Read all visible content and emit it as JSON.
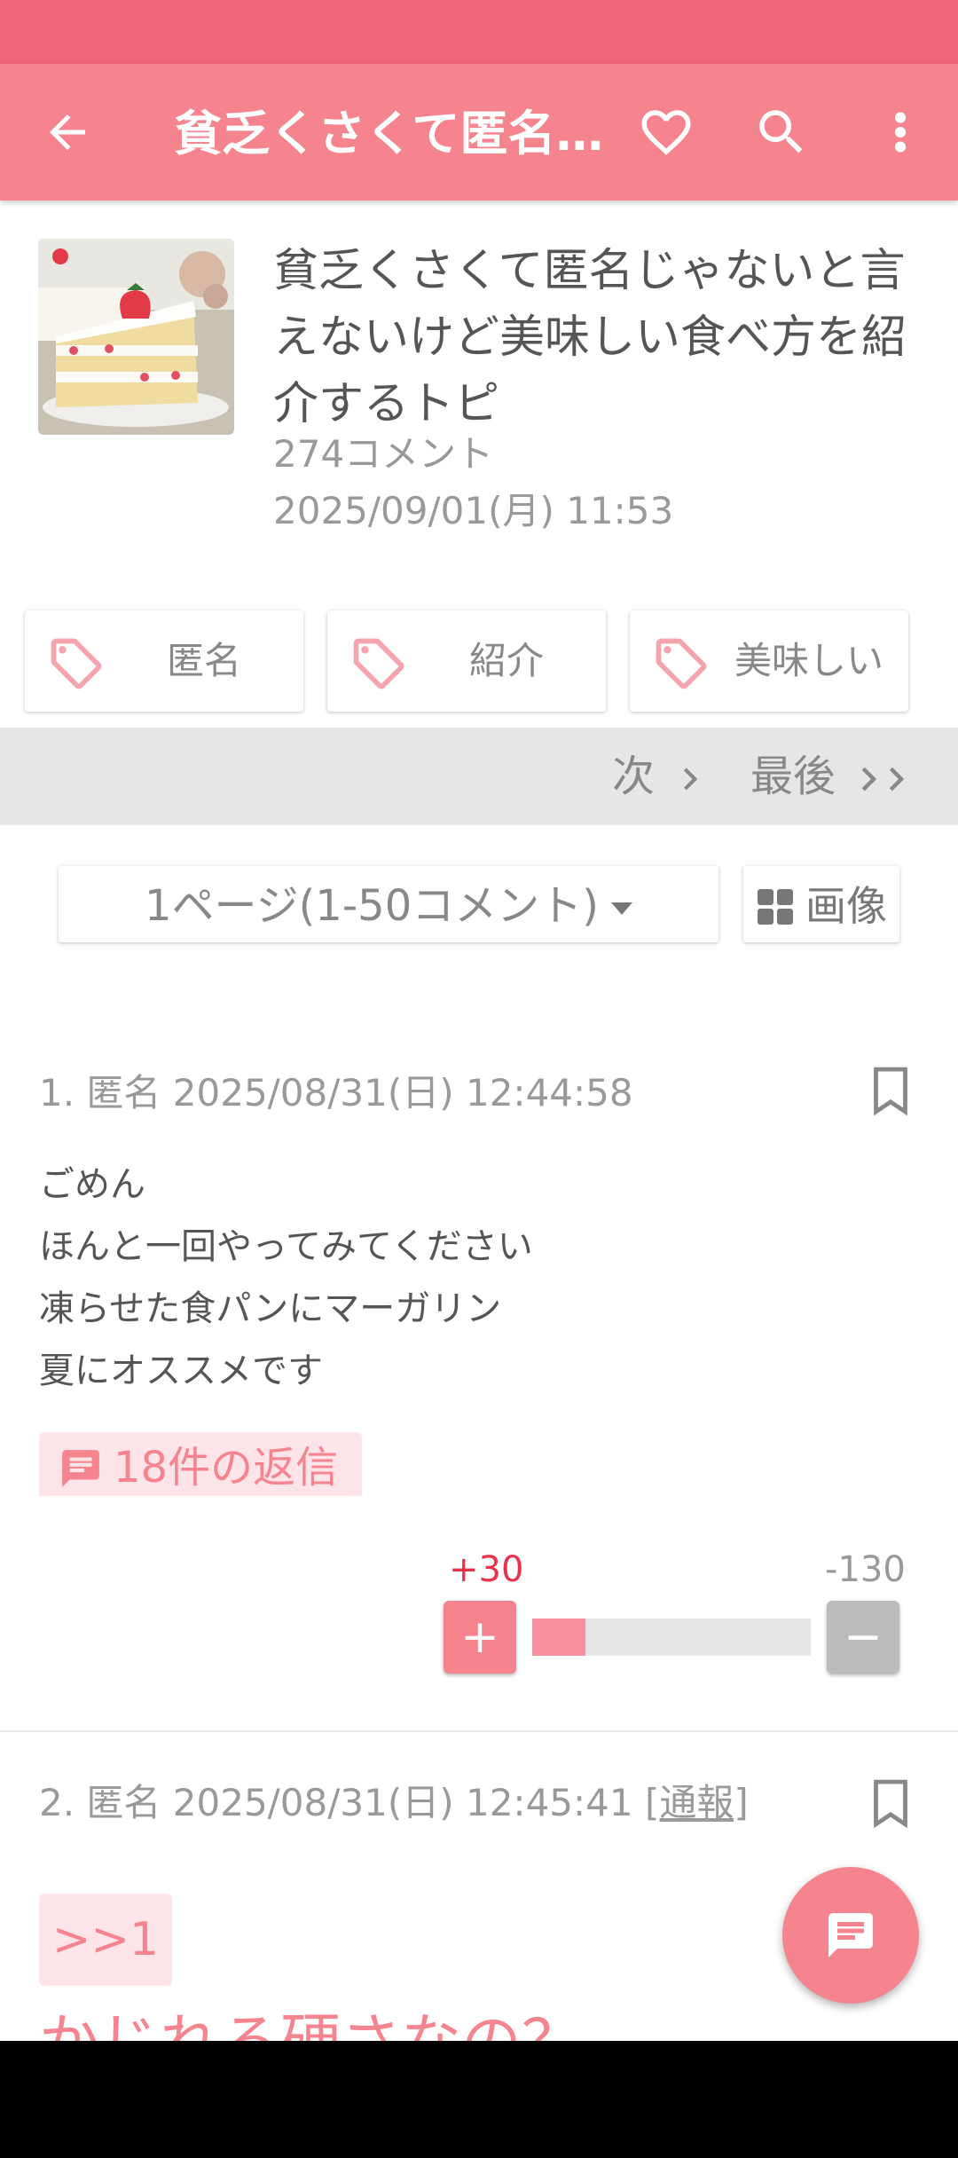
{
  "app_bar": {
    "title": "貧乏くさくて匿名…",
    "back_icon": "arrow-left-icon",
    "favorite_icon": "heart-outline-icon",
    "search_icon": "search-icon",
    "more_icon": "more-vert-icon",
    "color": "#f5848f",
    "status_bar_color": "#f06477"
  },
  "topic": {
    "title": "貧乏くさくて匿名じゃないと言えないけど美味しい食べ方を紹介するトピ",
    "comment_count": "274コメント",
    "date": "2025/09/01(月) 11:53",
    "thumbnail": "strawberry-shortcake-image"
  },
  "tags": [
    {
      "label": "匿名"
    },
    {
      "label": "紹介"
    },
    {
      "label": "美味しい"
    }
  ],
  "pager": {
    "next_label": "次",
    "last_label": "最後"
  },
  "page_select": {
    "selected": "1ページ(1-50コメント)",
    "image_button": "画像"
  },
  "comments": [
    {
      "meta": "1. 匿名 2025/08/31(日) 12:44:58",
      "lines": [
        "ごめん",
        "ほんと一回やってみてください",
        "凍らせた食パンにマーガリン",
        "夏にオススメです"
      ],
      "reply_label": "18件の返信",
      "plus": "+30",
      "minus": "-130",
      "plus_symbol": "+",
      "minus_symbol": "−",
      "positive_ratio": 0.19
    },
    {
      "meta": "2. 匿名 2025/08/31(日) 12:45:41",
      "report_label": "[通報]",
      "quote": ">>1",
      "text": "かじれる硬さなの？"
    }
  ],
  "accent_color": "#f5848f"
}
